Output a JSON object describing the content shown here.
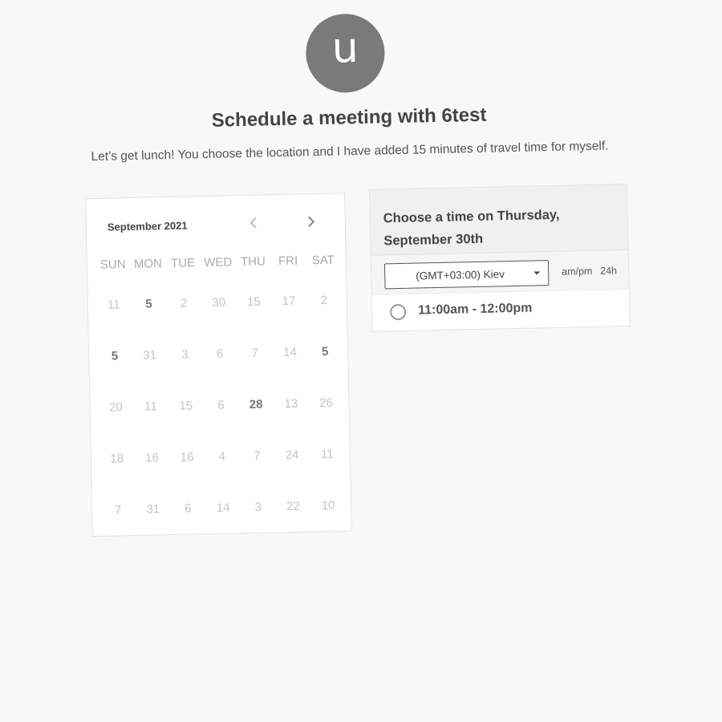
{
  "host": {
    "avatar_letter": "u",
    "title": "Schedule a meeting with 6test",
    "description": "Let’s get lunch! You choose the location and I have added 15 minutes of travel time for myself."
  },
  "calendar": {
    "month_label": "September 2021",
    "prev_icon": "chevron-left-icon",
    "next_icon": "chevron-right-icon",
    "weekdays": [
      "SUN",
      "MON",
      "TUE",
      "WED",
      "THU",
      "FRI",
      "SAT"
    ],
    "weeks": [
      [
        "11",
        "5",
        "2",
        "30",
        "15",
        "17",
        "2"
      ],
      [
        "5",
        "31",
        "3",
        "6",
        "7",
        "14",
        "5"
      ],
      [
        "20",
        "11",
        "15",
        "6",
        "28",
        "13",
        "26"
      ],
      [
        "18",
        "16",
        "16",
        "4",
        "7",
        "24",
        "11"
      ],
      [
        "7",
        "31",
        "6",
        "14",
        "3",
        "22",
        "10"
      ]
    ],
    "available_days": [
      [
        0,
        1
      ],
      [
        1,
        0
      ],
      [
        1,
        6
      ],
      [
        2,
        4
      ]
    ]
  },
  "time_panel": {
    "title": "Choose a time on Thursday, September 30th",
    "timezone": {
      "selected": "(GMT+03:00) Kiev",
      "dropdown_icon": "caret-down-icon"
    },
    "format_ampm": "am/pm",
    "format_24h": "24h",
    "slots": [
      {
        "label": "11:00am - 12:00pm",
        "selected": false
      }
    ]
  },
  "colors": {
    "background": "#f8f8f8",
    "avatar": "#7a7a7a",
    "available_day": "#777777",
    "unavailable_day": "#c4c4c4"
  }
}
